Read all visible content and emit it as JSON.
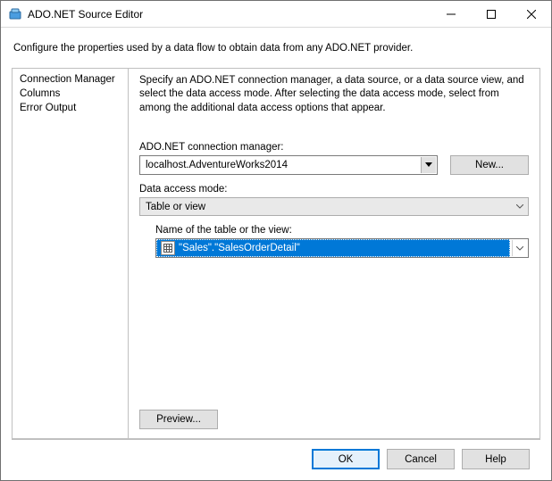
{
  "window": {
    "title": "ADO.NET Source Editor"
  },
  "intro": "Configure the properties used by a data flow to obtain data from any ADO.NET provider.",
  "sidebar": {
    "items": [
      {
        "label": "Connection Manager"
      },
      {
        "label": "Columns"
      },
      {
        "label": "Error Output"
      }
    ]
  },
  "panel": {
    "description": "Specify an ADO.NET connection manager, a data source, or a data source view, and select the data access mode. After selecting the data access mode, select from among the additional data access options that appear.",
    "conn_label": "ADO.NET connection manager:",
    "conn_value": "localhost.AdventureWorks2014",
    "new_button": "New...",
    "mode_label": "Data access mode:",
    "mode_value": "Table or view",
    "table_label": "Name of the table or the view:",
    "table_value": "\"Sales\".\"SalesOrderDetail\"",
    "preview_button": "Preview..."
  },
  "footer": {
    "ok": "OK",
    "cancel": "Cancel",
    "help": "Help"
  }
}
